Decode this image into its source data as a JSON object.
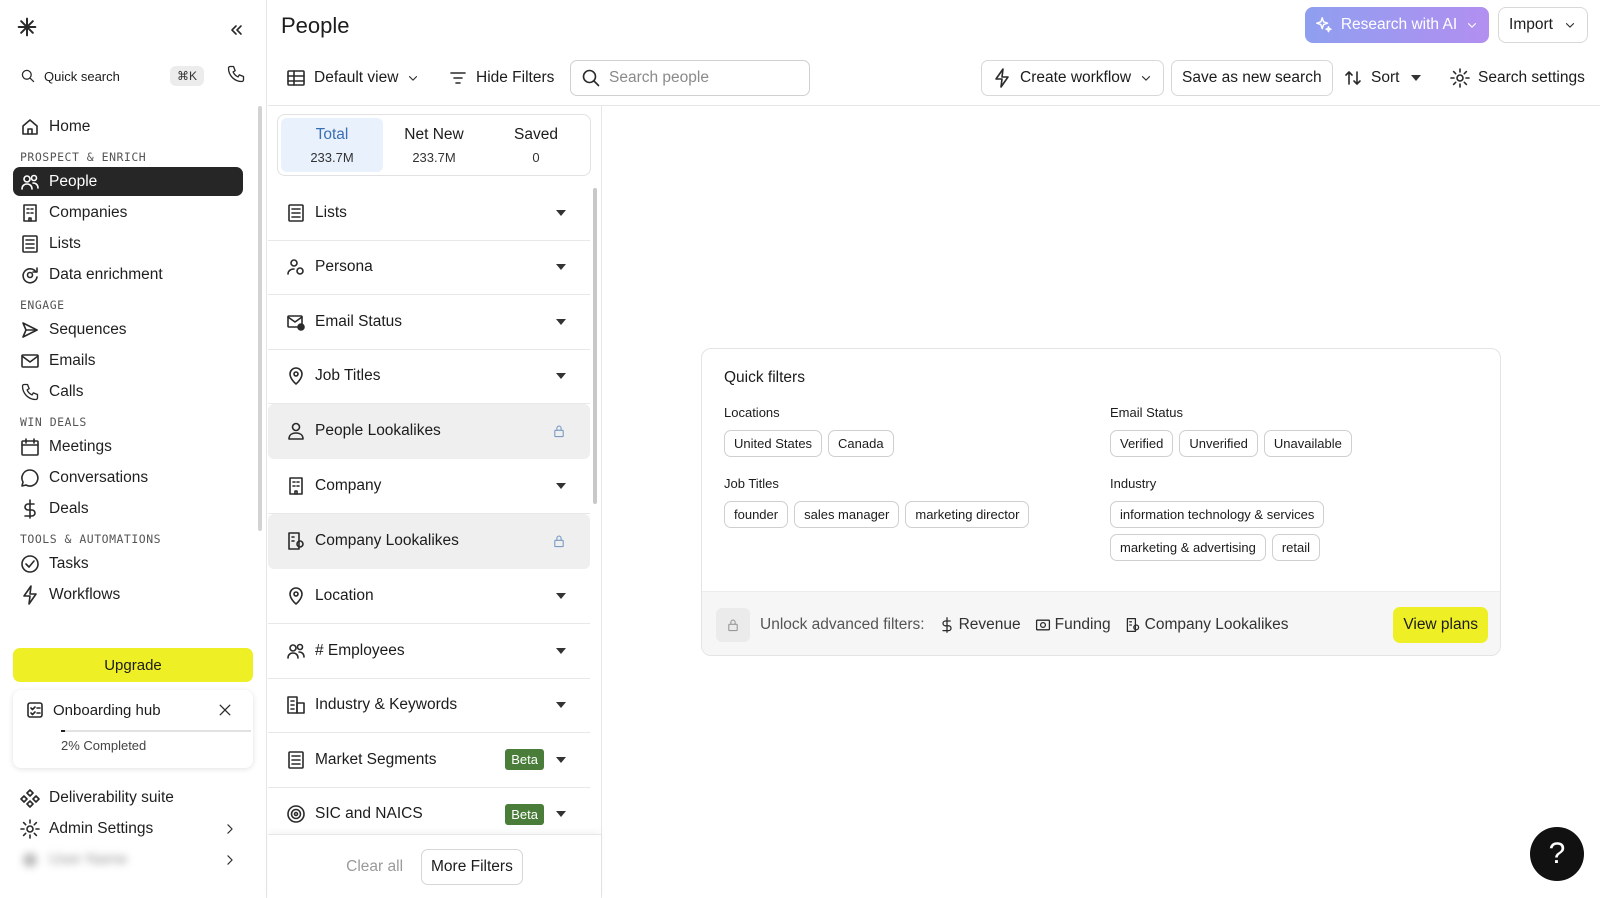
{
  "sidebar": {
    "quick_search": "Quick search",
    "shortcut": "⌘K",
    "home": "Home",
    "sections": {
      "prospect": "PROSPECT & ENRICH",
      "engage": "ENGAGE",
      "win": "WIN DEALS",
      "tools": "TOOLS & AUTOMATIONS"
    },
    "items": {
      "people": "People",
      "companies": "Companies",
      "lists": "Lists",
      "data_enrichment": "Data enrichment",
      "sequences": "Sequences",
      "emails": "Emails",
      "calls": "Calls",
      "meetings": "Meetings",
      "conversations": "Conversations",
      "deals": "Deals",
      "tasks": "Tasks",
      "workflows": "Workflows"
    },
    "upgrade": "Upgrade",
    "onboarding": {
      "title": "Onboarding hub",
      "progress_text": "2% Completed",
      "progress": 0.02
    },
    "deliverability": "Deliverability suite",
    "admin": "Admin Settings",
    "account": "User Name"
  },
  "header": {
    "title": "People",
    "research": "Research with AI",
    "import": "Import"
  },
  "toolbar": {
    "default_view": "Default view",
    "hide_filters": "Hide Filters",
    "search_placeholder": "Search people",
    "create_workflow": "Create workflow",
    "save_search": "Save as new search",
    "sort": "Sort",
    "search_settings": "Search settings"
  },
  "tabs": [
    {
      "label": "Total",
      "value": "233.7M"
    },
    {
      "label": "Net New",
      "value": "233.7M"
    },
    {
      "label": "Saved",
      "value": "0"
    }
  ],
  "filters": {
    "lists": "Lists",
    "persona": "Persona",
    "email_status": "Email Status",
    "job_titles": "Job Titles",
    "people_lookalikes": "People Lookalikes",
    "company": "Company",
    "company_lookalikes": "Company Lookalikes",
    "location": "Location",
    "employees": "# Employees",
    "industry": "Industry & Keywords",
    "market_segments": "Market Segments",
    "sic_naics": "SIC and NAICS",
    "beta": "Beta",
    "clear_all": "Clear all",
    "more_filters": "More Filters"
  },
  "quick_filters": {
    "title": "Quick filters",
    "locations": {
      "label": "Locations",
      "chips": [
        "United States",
        "Canada"
      ]
    },
    "email_status": {
      "label": "Email Status",
      "chips": [
        "Verified",
        "Unverified",
        "Unavailable"
      ]
    },
    "job_titles": {
      "label": "Job Titles",
      "chips": [
        "founder",
        "sales manager",
        "marketing director"
      ]
    },
    "industry": {
      "label": "Industry",
      "chips": [
        "information technology & services",
        "marketing & advertising",
        "retail"
      ]
    },
    "unlock": "Unlock advanced filters:",
    "revenue": "Revenue",
    "funding": "Funding",
    "company_lookalikes": "Company Lookalikes",
    "view_plans": "View plans"
  },
  "help": "?"
}
